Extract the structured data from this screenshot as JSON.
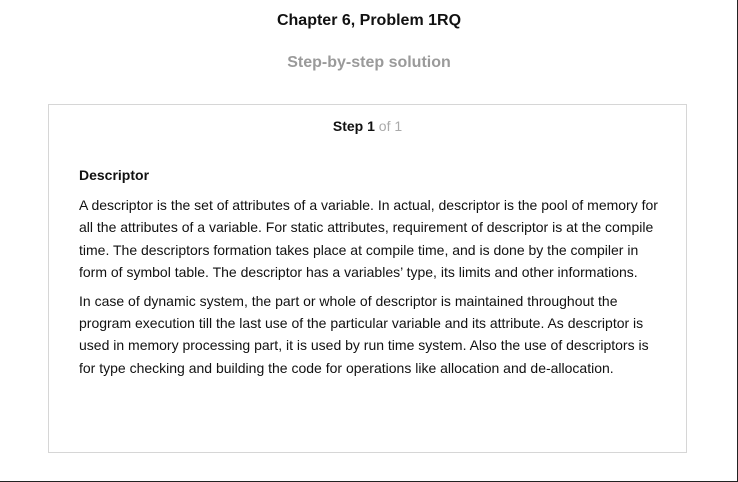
{
  "header": {
    "title": "Chapter 6, Problem 1RQ",
    "subtitle": "Step-by-step solution"
  },
  "step": {
    "label": "Step",
    "current": "1",
    "total_text": "of 1"
  },
  "content": {
    "heading": "Descriptor",
    "paragraphs": [
      "A descriptor is the set of attributes of a variable. In actual, descriptor is the pool of memory for all the attributes of a variable. For static attributes, requirement of descriptor is at the compile time. The descriptors formation takes place at compile time, and is done by the compiler in form of symbol table. The descriptor has a variables’ type, its limits and other informations.",
      "In case of dynamic system, the part or whole of descriptor is maintained throughout the program execution till the last use of the particular variable and its attribute. As descriptor is used in memory processing part, it is used by run time system. Also the use of descriptors is for type checking and building the code for operations like allocation and de-allocation."
    ]
  }
}
